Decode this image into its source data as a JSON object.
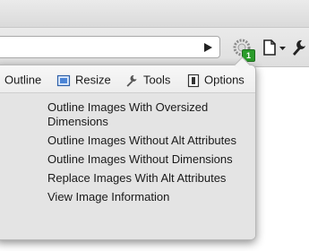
{
  "toolbar": {
    "extension_badge": "1"
  },
  "popup": {
    "tabs": [
      {
        "label": "Outline",
        "icon": "outline-icon"
      },
      {
        "label": "Resize",
        "icon": "resize-icon"
      },
      {
        "label": "Tools",
        "icon": "wrench-icon"
      },
      {
        "label": "Options",
        "icon": "options-icon"
      }
    ],
    "menu": {
      "items": [
        {
          "label": "Outline Images With Oversized Dimensions"
        },
        {
          "label": "Outline Images Without Alt Attributes"
        },
        {
          "label": "Outline Images Without Dimensions"
        },
        {
          "label": "Replace Images With Alt Attributes"
        },
        {
          "label": "View Image Information"
        }
      ]
    }
  }
}
